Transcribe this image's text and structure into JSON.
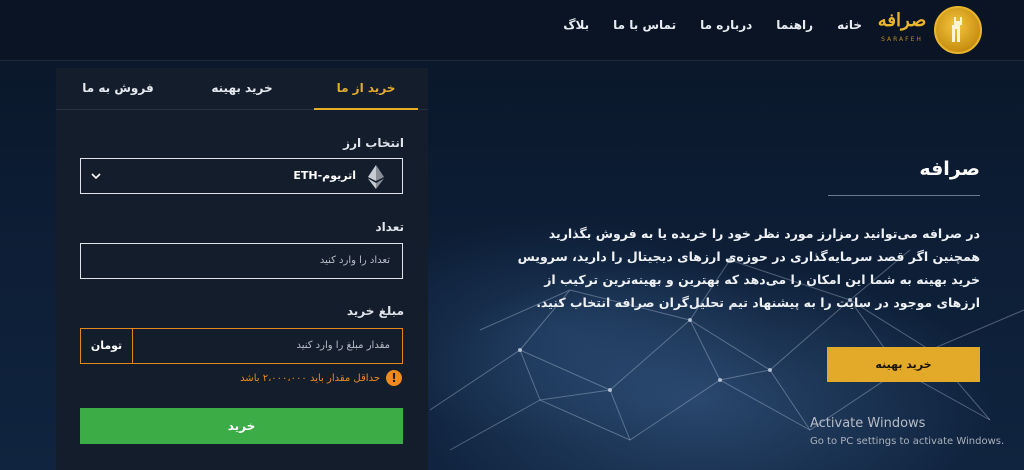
{
  "header": {
    "logo_text": "صرافه",
    "logo_sub": "SARAFEH",
    "nav": [
      "خانه",
      "راهنما",
      "درباره ما",
      "تماس با ما",
      "بلاگ"
    ]
  },
  "form": {
    "tabs": [
      "خرید از ما",
      "خرید بهینه",
      "فروش به ما"
    ],
    "currency_label": "انتخاب ارز",
    "currency_value": "اتریوم-ETH",
    "quantity_label": "تعداد",
    "quantity_placeholder": "تعداد را وارد کنید",
    "amount_label": "مبلغ خرید",
    "amount_placeholder": "مقدار مبلغ را وارد کنید",
    "amount_unit": "تومان",
    "warning": "حداقل مقدار باید ۲،۰۰۰،۰۰۰ باشد",
    "submit": "خرید"
  },
  "content": {
    "title": "صرافه",
    "body": "در صرافه می‌توانید رمزارز مورد نظر خود را خریده یا به فروش بگذارید همچنین اگر قصد سرمایه‌گذاری در حوزه‌ی ارزهای دیجیتال را دارید، سرویس خرید بهینه به شما این امکان را می‌دهد که بهترین و بهینه‌ترین ترکیب از ارزهای موجود در سایت را به پیشنهاد تیم تحلیل‌گران صرافه انتخاب کنید.",
    "button": "خرید بهینه"
  },
  "watermark": {
    "title": "Activate Windows",
    "subtitle": "Go to PC settings to activate Windows."
  },
  "colors": {
    "accent": "#e4ad2a",
    "success": "#3cac47",
    "warning": "#f08a1d"
  }
}
